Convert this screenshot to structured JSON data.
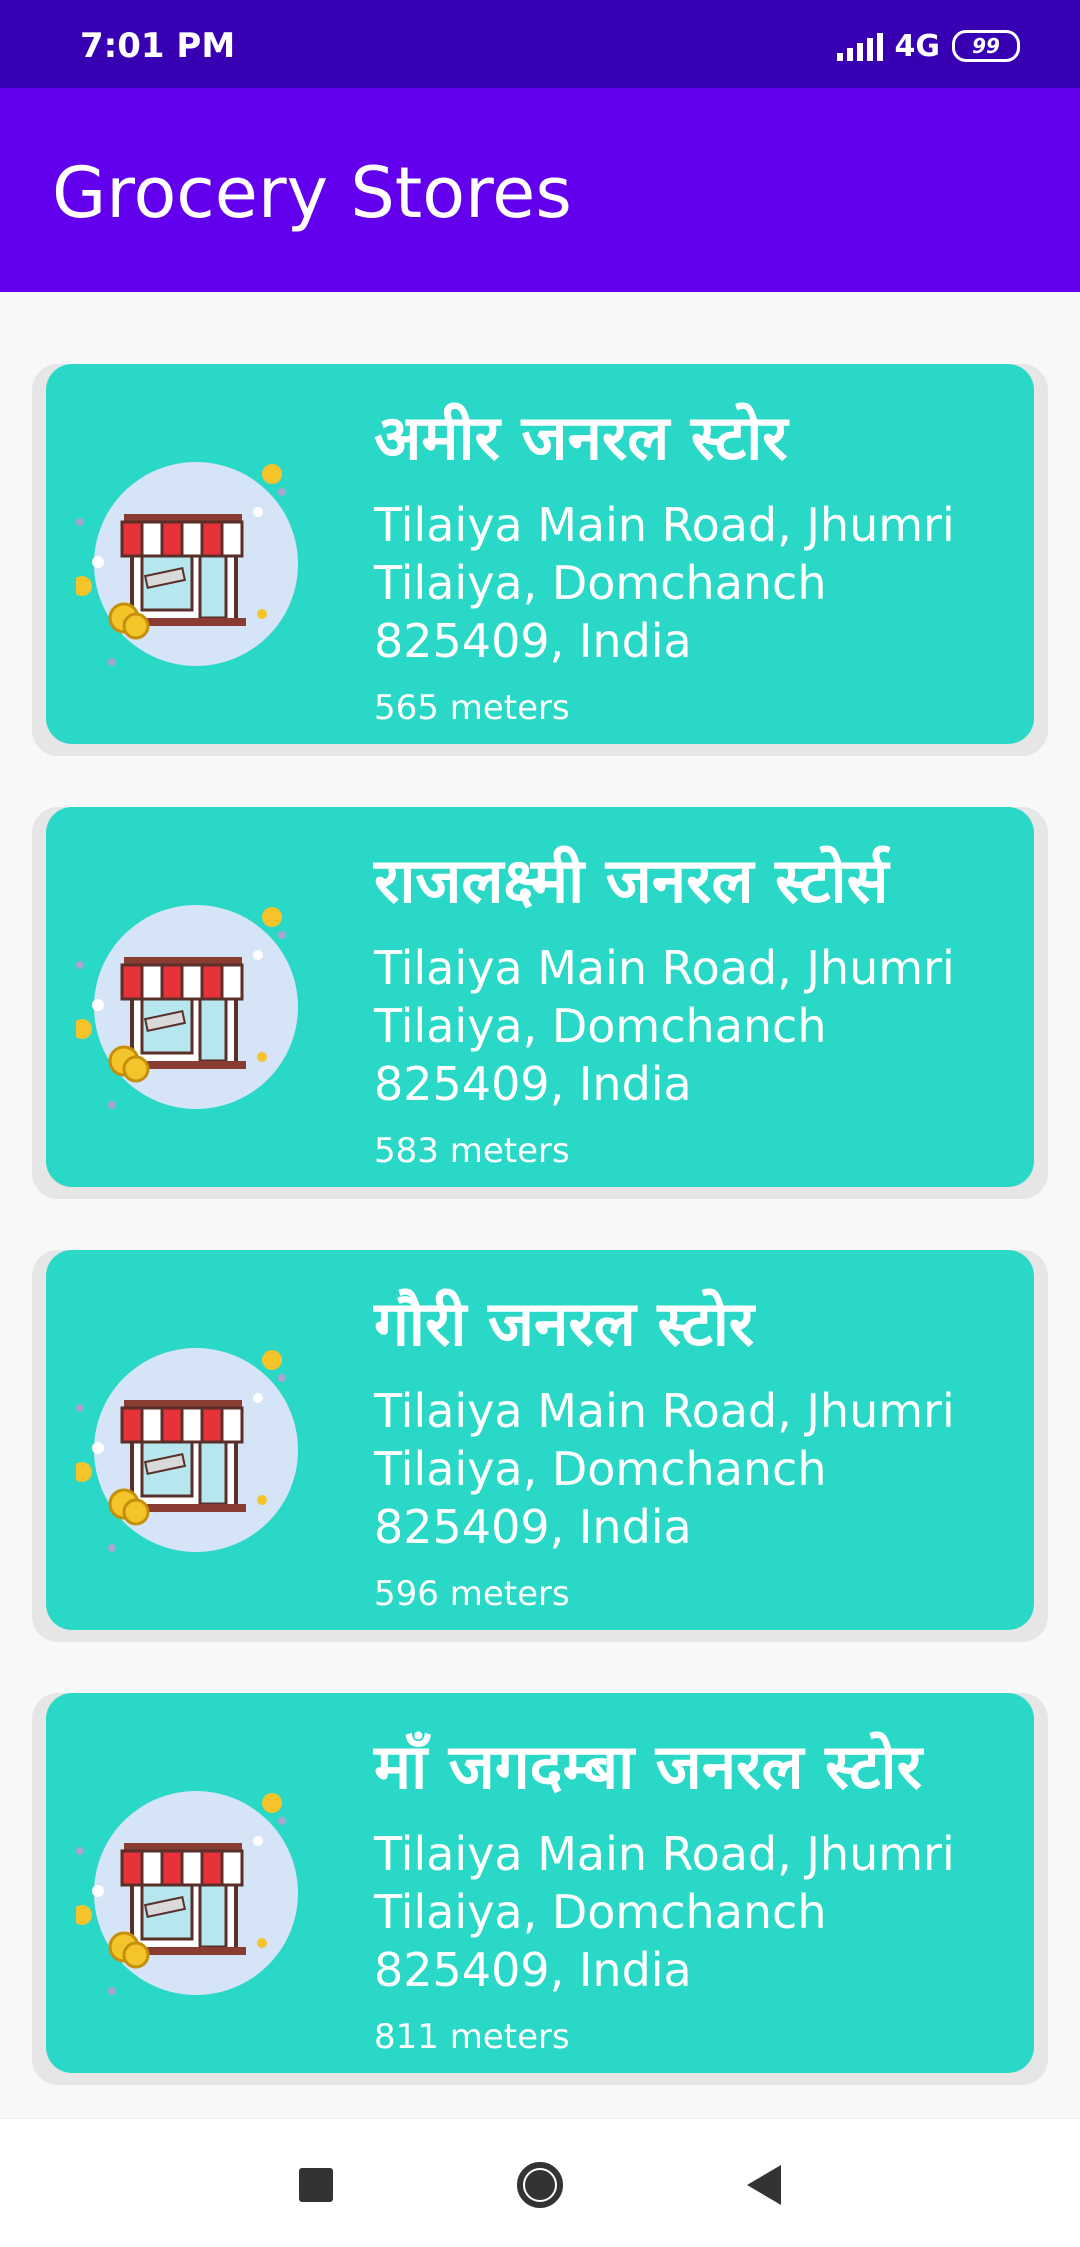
{
  "status_bar": {
    "time": "7:01 PM",
    "network": "4G",
    "battery": "99"
  },
  "app_bar": {
    "title": "Grocery Stores"
  },
  "stores": [
    {
      "name": "अमीर जनरल स्टोर",
      "address": "Tilaiya Main Road, Jhumri Tilaiya, Domchanch 825409, India",
      "distance": "565 meters"
    },
    {
      "name": "राजलक्ष्मी जनरल स्टोर्स",
      "address": "Tilaiya Main Road, Jhumri Tilaiya, Domchanch 825409, India",
      "distance": "583 meters"
    },
    {
      "name": "गौरी जनरल स्टोर",
      "address": "Tilaiya Main Road, Jhumri Tilaiya, Domchanch 825409, India",
      "distance": "596 meters"
    },
    {
      "name": "माँ जगदम्बा जनरल स्टोर",
      "address": "Tilaiya Main Road, Jhumri Tilaiya, Domchanch 825409, India",
      "distance": "811 meters"
    }
  ],
  "nav": {
    "icons": [
      "square-recents-icon",
      "circle-home-icon",
      "triangle-back-icon"
    ]
  },
  "colors": {
    "status_bar": "#3700b3",
    "app_bar": "#6200ee",
    "card": "#2ad8c7"
  }
}
